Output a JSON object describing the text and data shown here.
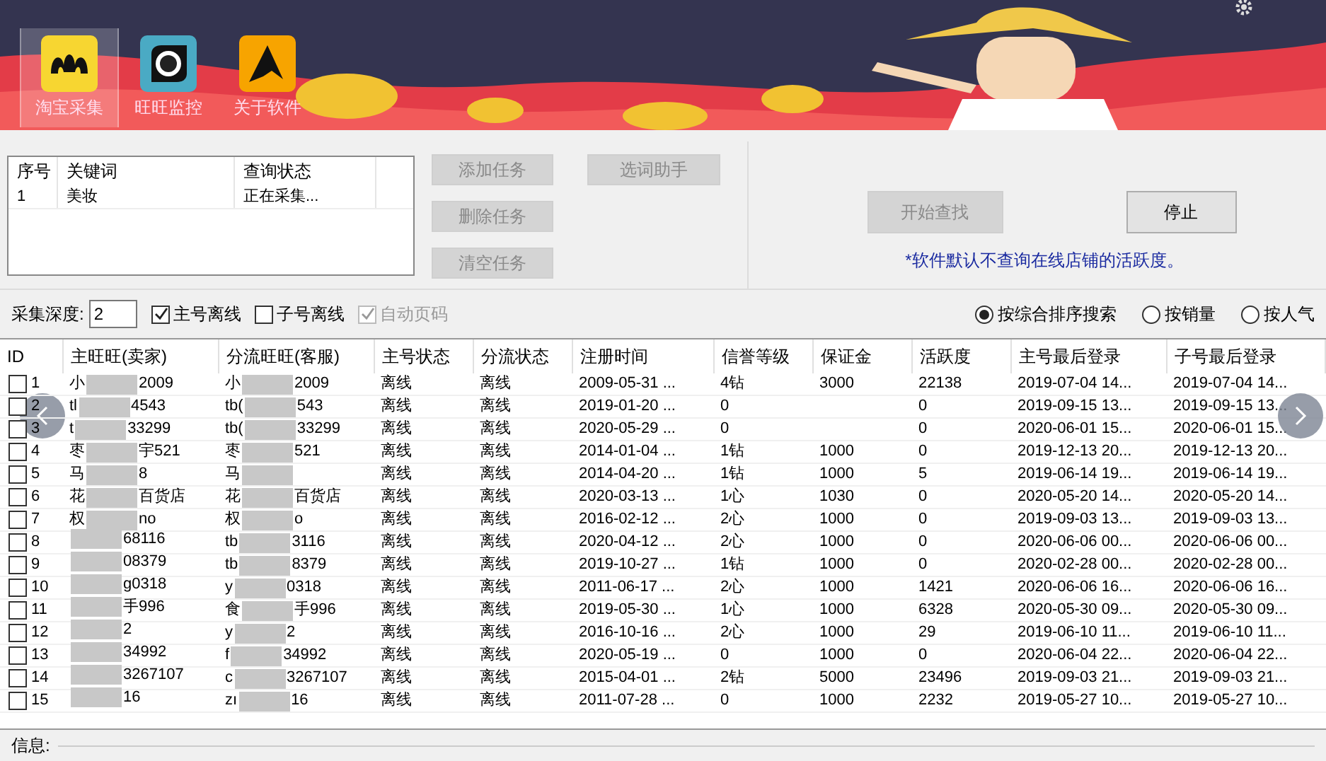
{
  "toolbar": [
    {
      "label": "淘宝采集",
      "kind": "taobao",
      "selected": true
    },
    {
      "label": "旺旺监控",
      "kind": "monitor",
      "selected": false
    },
    {
      "label": "关于软件",
      "kind": "about",
      "selected": false
    }
  ],
  "task_list": {
    "columns": [
      "序号",
      "关键词",
      "查询状态"
    ],
    "rows": [
      [
        "1",
        "美妆",
        "正在采集..."
      ]
    ]
  },
  "task_buttons": [
    {
      "label": "添加任务",
      "disabled": true
    },
    {
      "label": "删除任务",
      "disabled": true
    },
    {
      "label": "清空任务",
      "disabled": true
    }
  ],
  "helper_button": {
    "label": "选词助手",
    "disabled": true
  },
  "start_button": {
    "label": "开始查找",
    "disabled": true
  },
  "stop_button": {
    "label": "停止",
    "disabled": false
  },
  "note": "*软件默认不查询在线店铺的活跃度。",
  "depth": {
    "label": "采集深度:",
    "value": "2"
  },
  "options": [
    {
      "label": "主号离线",
      "checked": true,
      "disabled": false
    },
    {
      "label": "子号离线",
      "checked": false,
      "disabled": false
    },
    {
      "label": "自动页码",
      "checked": true,
      "disabled": true
    }
  ],
  "sort": [
    {
      "label": "按综合排序搜索",
      "selected": true
    },
    {
      "label": "按销量",
      "selected": false
    },
    {
      "label": "按人气",
      "selected": false
    }
  ],
  "table": {
    "columns": [
      "ID",
      "主旺旺(卖家)",
      "分流旺旺(客服)",
      "主号状态",
      "分流状态",
      "注册时间",
      "信誉等级",
      "保证金",
      "活跃度",
      "主号最后登录",
      "子号最后登录"
    ],
    "rows": [
      {
        "checked": false,
        "id": "1",
        "main": {
          "start": "小",
          "end": "2009"
        },
        "sub": {
          "start": "小",
          "end": "2009"
        },
        "main_status": "离线",
        "sub_status": "离线",
        "registered": "2009-05-31 ...",
        "credit": "4钻",
        "deposit": "3000",
        "activity": "22138",
        "main_login": "2019-07-04 14...",
        "sub_login": "2019-07-04 14..."
      },
      {
        "checked": false,
        "id": "2",
        "main": {
          "start": "tl",
          "end": "4543"
        },
        "sub": {
          "start": "tb(",
          "end": "543"
        },
        "main_status": "离线",
        "sub_status": "离线",
        "registered": "2019-01-20 ...",
        "credit": "0",
        "activity": "0",
        "main_login": "2019-09-15 13...",
        "sub_login": "2019-09-15 13..."
      },
      {
        "checked": false,
        "id": "3",
        "main": {
          "start": "t",
          "end": "33299"
        },
        "sub": {
          "start": "tb(",
          "end": "33299"
        },
        "main_status": "离线",
        "sub_status": "离线",
        "registered": "2020-05-29 ...",
        "credit": "0",
        "activity": "0",
        "main_login": "2020-06-01 15...",
        "sub_login": "2020-06-01 15..."
      },
      {
        "checked": false,
        "id": "4",
        "main": {
          "start": "枣",
          "end": "宇521"
        },
        "sub": {
          "start": "枣",
          "end": "521"
        },
        "main_status": "离线",
        "sub_status": "离线",
        "registered": "2014-01-04 ...",
        "credit": "1钻",
        "deposit": "1000",
        "activity": "0",
        "main_login": "2019-12-13 20...",
        "sub_login": "2019-12-13 20..."
      },
      {
        "checked": false,
        "id": "5",
        "main": {
          "start": "马",
          "end": "8"
        },
        "sub": {
          "start": "马"
        },
        "main_status": "离线",
        "sub_status": "离线",
        "registered": "2014-04-20 ...",
        "credit": "1钻",
        "deposit": "1000",
        "activity": "5",
        "main_login": "2019-06-14 19...",
        "sub_login": "2019-06-14 19..."
      },
      {
        "checked": false,
        "id": "6",
        "main": {
          "start": "花",
          "end": "百货店"
        },
        "sub": {
          "start": "花",
          "end": "百货店"
        },
        "main_status": "离线",
        "sub_status": "离线",
        "registered": "2020-03-13 ...",
        "credit": "1心",
        "deposit": "1030",
        "activity": "0",
        "main_login": "2020-05-20 14...",
        "sub_login": "2020-05-20 14..."
      },
      {
        "checked": false,
        "id": "7",
        "main": {
          "start": "权",
          "end": "no"
        },
        "sub": {
          "start": "权",
          "end": "o"
        },
        "main_status": "离线",
        "sub_status": "离线",
        "registered": "2016-02-12 ...",
        "credit": "2心",
        "deposit": "1000",
        "activity": "0",
        "main_login": "2019-09-03 13...",
        "sub_login": "2019-09-03 13..."
      },
      {
        "checked": false,
        "id": "8",
        "main": {
          "end": "68116"
        },
        "sub": {
          "start": "tb",
          "end": "3116"
        },
        "main_status": "离线",
        "sub_status": "离线",
        "registered": "2020-04-12 ...",
        "credit": "2心",
        "deposit": "1000",
        "activity": "0",
        "main_login": "2020-06-06 00...",
        "sub_login": "2020-06-06 00..."
      },
      {
        "checked": false,
        "id": "9",
        "main": {
          "end": "08379"
        },
        "sub": {
          "start": "tb",
          "end": "8379"
        },
        "main_status": "离线",
        "sub_status": "离线",
        "registered": "2019-10-27 ...",
        "credit": "1钻",
        "deposit": "1000",
        "activity": "0",
        "main_login": "2020-02-28 00...",
        "sub_login": "2020-02-28 00..."
      },
      {
        "checked": false,
        "id": "10",
        "main": {
          "end": "g0318"
        },
        "sub": {
          "start": "y",
          "end": "0318"
        },
        "main_status": "离线",
        "sub_status": "离线",
        "registered": "2011-06-17 ...",
        "credit": "2心",
        "deposit": "1000",
        "activity": "1421",
        "main_login": "2020-06-06 16...",
        "sub_login": "2020-06-06 16..."
      },
      {
        "checked": false,
        "id": "11",
        "main": {
          "end": "手996"
        },
        "sub": {
          "start": "食",
          "end": "手996"
        },
        "main_status": "离线",
        "sub_status": "离线",
        "registered": "2019-05-30 ...",
        "credit": "1心",
        "deposit": "1000",
        "activity": "6328",
        "main_login": "2020-05-30 09...",
        "sub_login": "2020-05-30 09..."
      },
      {
        "checked": false,
        "id": "12",
        "main": {
          "end": "2"
        },
        "sub": {
          "start": "y",
          "end": "2"
        },
        "main_status": "离线",
        "sub_status": "离线",
        "registered": "2016-10-16 ...",
        "credit": "2心",
        "deposit": "1000",
        "activity": "29",
        "main_login": "2019-06-10 11...",
        "sub_login": "2019-06-10 11..."
      },
      {
        "checked": false,
        "id": "13",
        "main": {
          "end": "34992"
        },
        "sub": {
          "start": "f",
          "end": "34992"
        },
        "main_status": "离线",
        "sub_status": "离线",
        "registered": "2020-05-19 ...",
        "credit": "0",
        "deposit": "1000",
        "activity": "0",
        "main_login": "2020-06-04 22...",
        "sub_login": "2020-06-04 22..."
      },
      {
        "checked": false,
        "id": "14",
        "main": {
          "end": "3267107"
        },
        "sub": {
          "start": "c",
          "end": "3267107"
        },
        "main_status": "离线",
        "sub_status": "离线",
        "registered": "2015-04-01 ...",
        "credit": "2钻",
        "deposit": "5000",
        "activity": "23496",
        "main_login": "2019-09-03 21...",
        "sub_login": "2019-09-03 21..."
      },
      {
        "checked": false,
        "id": "15",
        "main": {
          "end": "16"
        },
        "sub": {
          "start": "zı",
          "end": "16"
        },
        "main_status": "离线",
        "sub_status": "离线",
        "registered": "2011-07-28 ...",
        "credit": "0",
        "deposit": "1000",
        "activity": "2232",
        "main_login": "2019-05-27 10...",
        "sub_login": "2019-05-27 10..."
      }
    ]
  },
  "status_bar": {
    "label": "信息:"
  }
}
